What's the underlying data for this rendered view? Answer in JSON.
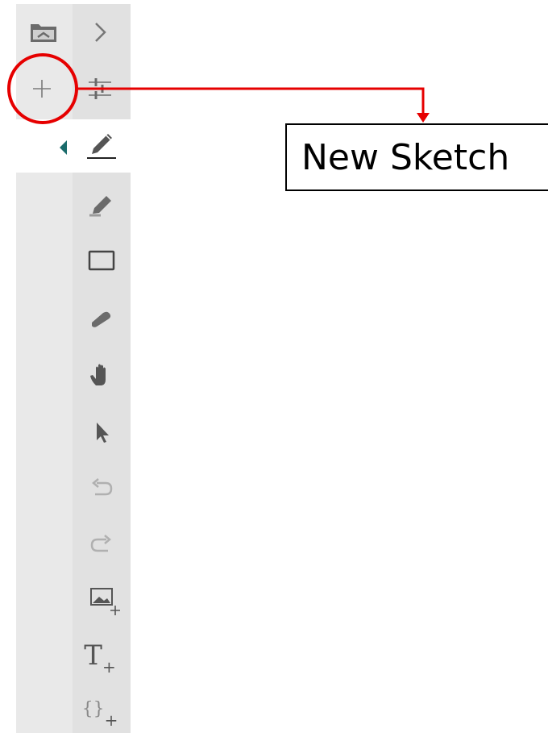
{
  "toolbar": {
    "tools": [
      {
        "name": "open-folder",
        "icon": "folder-icon"
      },
      {
        "name": "expand",
        "icon": "chevron-right-icon"
      },
      {
        "name": "new-sketch",
        "icon": "plus-icon"
      },
      {
        "name": "settings",
        "icon": "sliders-icon"
      },
      {
        "name": "pen",
        "icon": "pencil-icon",
        "selected": true
      },
      {
        "name": "highlighter",
        "icon": "highlighter-icon"
      },
      {
        "name": "rectangle",
        "icon": "rectangle-icon"
      },
      {
        "name": "eraser",
        "icon": "eraser-icon"
      },
      {
        "name": "pan",
        "icon": "hand-icon"
      },
      {
        "name": "select",
        "icon": "pointer-icon"
      },
      {
        "name": "undo",
        "icon": "undo-icon"
      },
      {
        "name": "redo",
        "icon": "redo-icon"
      },
      {
        "name": "insert-image",
        "icon": "image-plus-icon"
      },
      {
        "name": "insert-text",
        "icon": "text-plus-icon"
      },
      {
        "name": "insert-code",
        "icon": "braces-plus-icon"
      }
    ],
    "text_tool_glyph": "T",
    "code_tool_glyph": "{}",
    "plus_glyph": "+"
  },
  "callout": {
    "label": "New Sketch",
    "color": "#e60000"
  },
  "colors": {
    "accent_teal": "#1a6b6b",
    "icon_gray": "#555555"
  }
}
